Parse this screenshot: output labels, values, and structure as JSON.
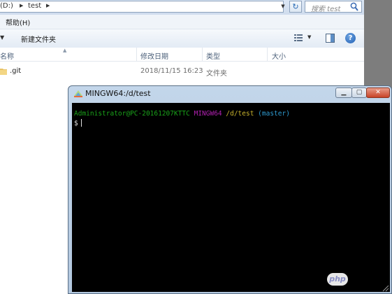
{
  "explorer": {
    "address": {
      "drive": "(D:)",
      "folder": "test"
    },
    "search_placeholder": "搜索 test",
    "menu": {
      "help": "帮助(H)"
    },
    "toolbar": {
      "new_folder": "新建文件夹"
    },
    "columns": {
      "name": "名称",
      "modified": "修改日期",
      "type": "类型",
      "size": "大小"
    },
    "files": [
      {
        "name": ".git",
        "modified": "2018/11/15 16:23",
        "type": "文件夹",
        "icon": "folder-icon"
      }
    ]
  },
  "terminal": {
    "title": "MINGW64:/d/test",
    "prompt": {
      "user_host": "Administrator@PC-20161207KTTC",
      "shell": "MINGW64",
      "path": "/d/test",
      "branch": "(master)",
      "symbol": "$"
    },
    "colors": {
      "user_host": "#1aa31a",
      "shell": "#b021b0",
      "path": "#c8b32d",
      "branch": "#2e9bd1",
      "symbol": "#e0e0e0"
    }
  },
  "watermark": "php"
}
